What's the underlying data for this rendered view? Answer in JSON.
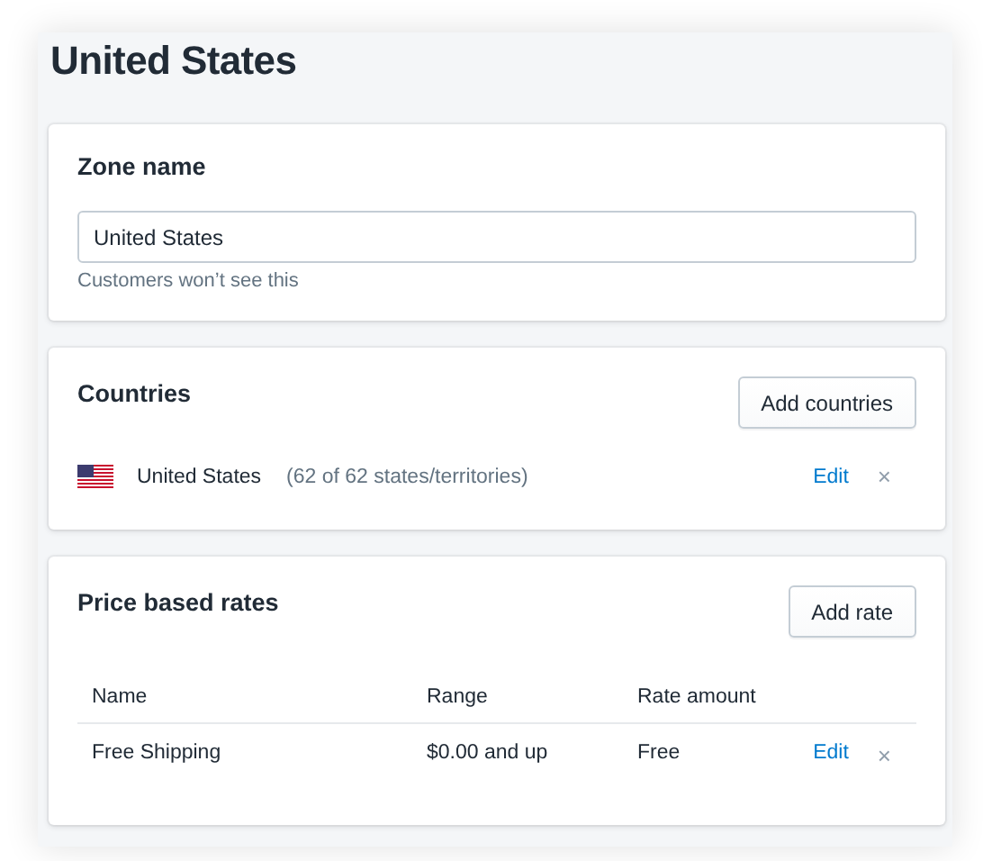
{
  "title": "United States",
  "zone": {
    "heading": "Zone name",
    "value": "United States",
    "help": "Customers won’t see this"
  },
  "countries": {
    "heading": "Countries",
    "button": "Add countries",
    "items": [
      {
        "name": "United States",
        "detail": "(62 of 62 states/territories)",
        "edit": "Edit",
        "remove": "×"
      }
    ]
  },
  "rates": {
    "heading": "Price based rates",
    "button": "Add rate",
    "columns": [
      "Name",
      "Range",
      "Rate amount"
    ],
    "rows": [
      {
        "cells": [
          "Free Shipping",
          "$0.00 and up",
          "Free"
        ],
        "edit": "Edit",
        "remove": "×"
      }
    ]
  }
}
